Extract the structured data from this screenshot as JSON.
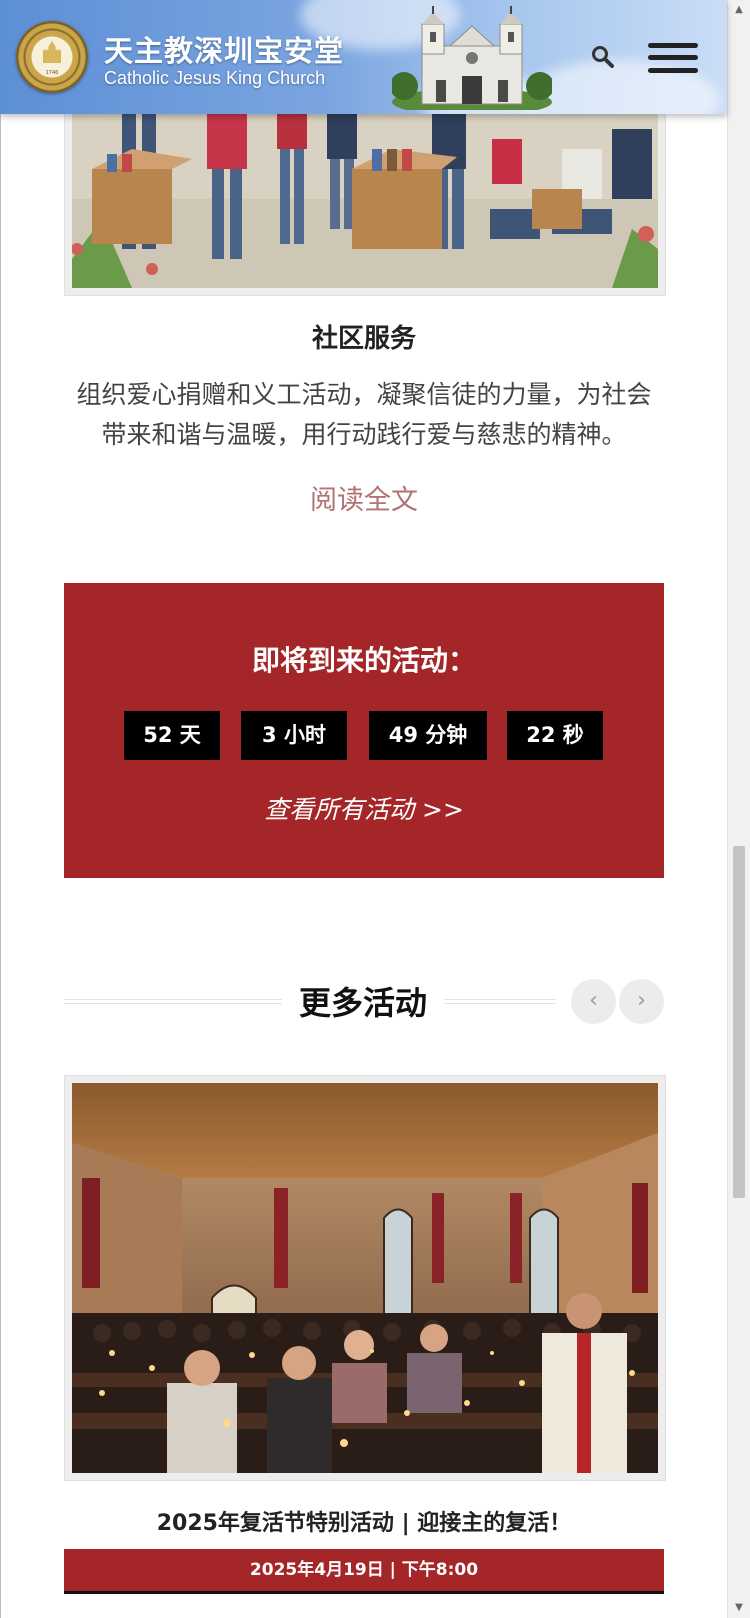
{
  "header": {
    "brand_cn": "天主教深圳宝安堂",
    "brand_en": "Catholic Jesus King Church",
    "logo_year": "1746"
  },
  "community": {
    "title": "社区服务",
    "desc_line1": "组织爱心捐赠和义工活动，凝聚信徒的力量，为社会",
    "desc_line2": "带来和谐与温暖，用行动践行爱与慈悲的精神。",
    "read_more": "阅读全文"
  },
  "countdown": {
    "title": "即将到来的活动：",
    "days": "52 天",
    "hours": "3 小时",
    "minutes": "49 分钟",
    "seconds": "22 秒",
    "link": "查看所有活动 >>"
  },
  "more_events": {
    "title": "更多活动",
    "prev": "‹",
    "next": "›",
    "event_title": "2025年复活节特别活动 | 迎接主的复活！",
    "event_date": "2025年4月19日 | 下午8:00"
  },
  "colors": {
    "accent_red": "#a42628",
    "read_more": "#b07373",
    "header_blue": "#6b9ae0"
  },
  "icons": [
    "search-icon",
    "hamburger-menu-icon",
    "chevron-left-icon",
    "chevron-right-icon"
  ]
}
